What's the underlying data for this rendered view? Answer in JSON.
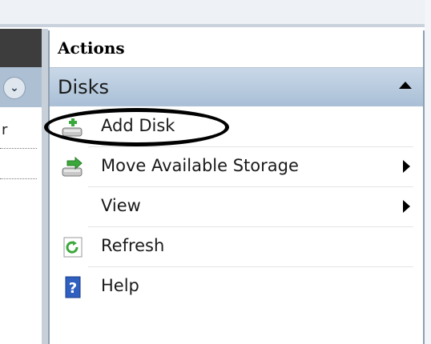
{
  "actions": {
    "title": "Actions",
    "section": "Disks",
    "items": [
      {
        "label": "Add Disk",
        "icon": "add-disk-icon",
        "has_submenu": false
      },
      {
        "label": "Move Available Storage",
        "icon": "move-storage-icon",
        "has_submenu": true
      },
      {
        "label": "View",
        "icon": "",
        "has_submenu": true
      },
      {
        "label": "Refresh",
        "icon": "refresh-icon",
        "has_submenu": false
      },
      {
        "label": "Help",
        "icon": "help-icon",
        "has_submenu": false
      }
    ]
  },
  "left_pane": {
    "visible_text": "r"
  },
  "colors": {
    "section_band": "#a9bfd6",
    "arrow_green": "#3aa83a",
    "help_blue": "#2f5fbf"
  }
}
